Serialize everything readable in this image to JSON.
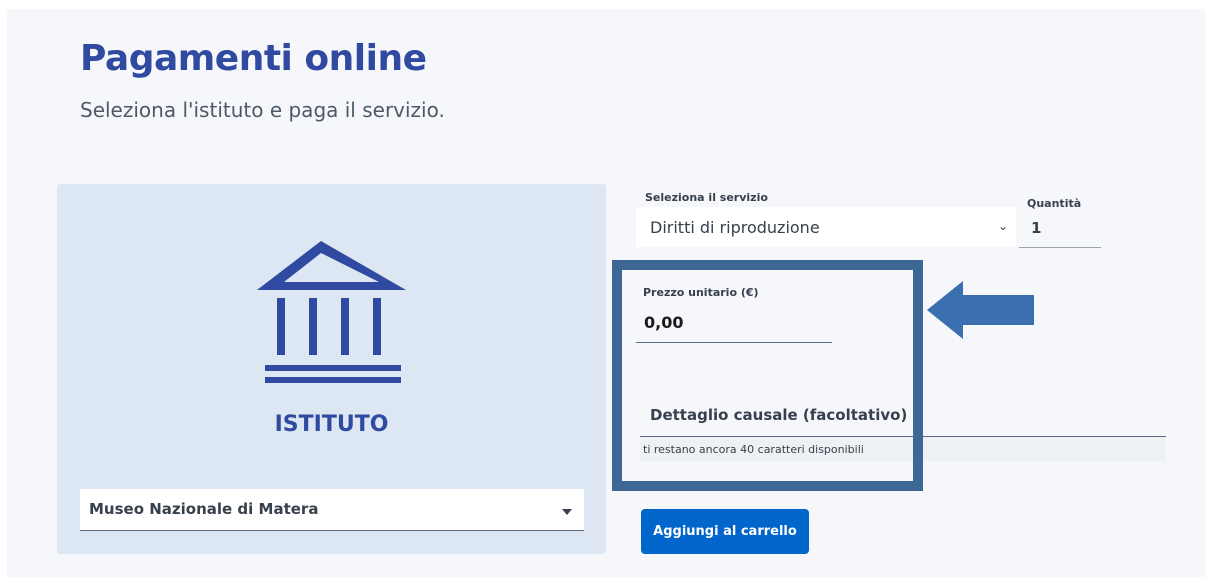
{
  "header": {
    "title": "Pagamenti online",
    "subtitle": "Seleziona l'istituto e paga il servizio."
  },
  "institute_panel": {
    "icon": "institution-building-icon",
    "label": "ISTITUTO",
    "select": {
      "value": "Museo Nazionale di Matera"
    }
  },
  "form": {
    "service": {
      "label": "Seleziona il servizio",
      "value": "Diritti di riproduzione"
    },
    "quantity": {
      "label": "Quantità",
      "value": "1"
    },
    "unit_price": {
      "label": "Prezzo unitario (€)",
      "value": "0,00"
    },
    "causale": {
      "label": "Dettaglio causale (facoltativo)",
      "counter": "ti restano ancora 40 caratteri disponibili"
    },
    "add_button_label": "Aggiungi al carrello"
  },
  "annotation": {
    "arrow_icon": "left-arrow-icon",
    "highlight_color": "#3d6896",
    "arrow_color": "#3a6fb0"
  },
  "colors": {
    "brand_blue": "#2f4aa0",
    "button_blue": "#0066cc",
    "panel_bg": "#dde7f3"
  }
}
